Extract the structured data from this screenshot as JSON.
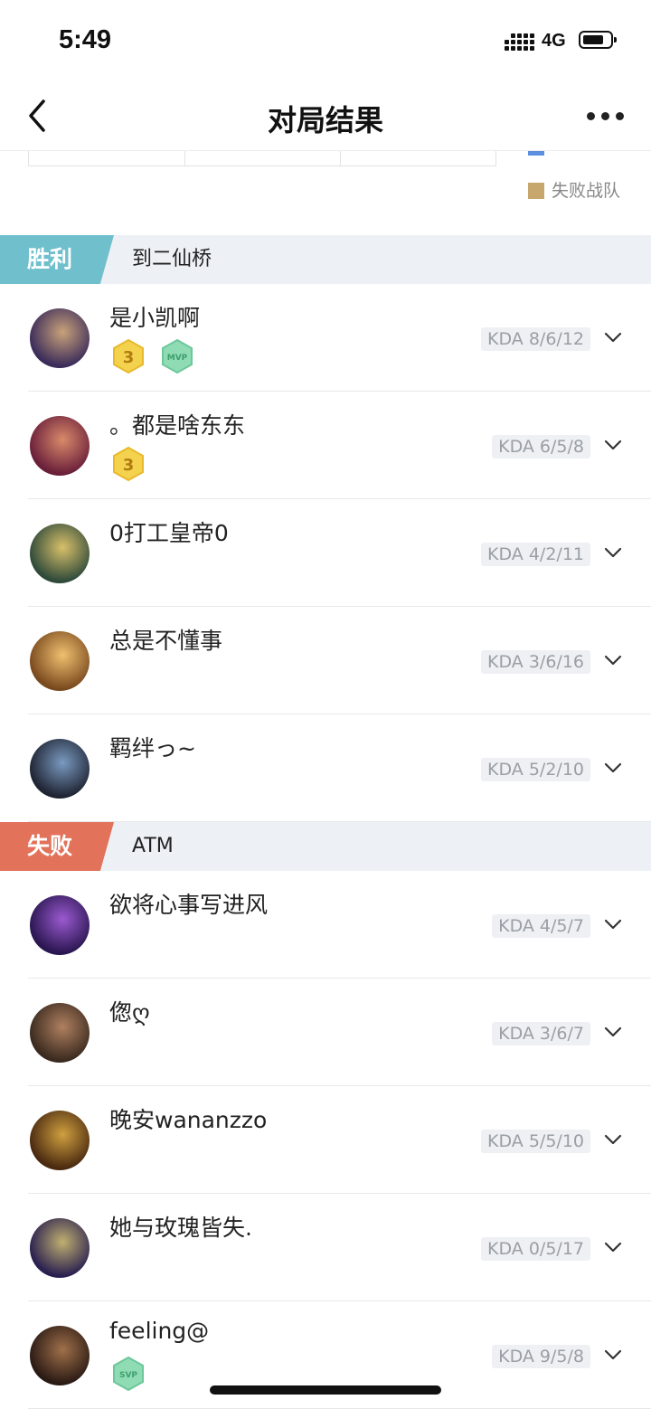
{
  "status_bar": {
    "time": "5:49",
    "network": "4G",
    "battery_level": 0.75
  },
  "nav": {
    "title": "对局结果",
    "back_icon": "chevron-left-icon",
    "more_icon": "more-horizontal-icon"
  },
  "legend": {
    "lose_label": "失败战队",
    "lose_color": "#c7a76e"
  },
  "colors": {
    "win_tag": "#6fbfcc",
    "lose_tag": "#e2725a"
  },
  "teams": [
    {
      "result": "胜利",
      "name": "到二仙桥",
      "players": [
        {
          "name": "是小凯啊",
          "kda": "KDA 8/6/12",
          "badges": [
            "3",
            "MVP"
          ]
        },
        {
          "name": "。都是啥东东",
          "kda": "KDA 6/5/8",
          "badges": [
            "3"
          ]
        },
        {
          "name": "0打工皇帝0",
          "kda": "KDA 4/2/11",
          "badges": []
        },
        {
          "name": "总是不懂事",
          "kda": "KDA 3/6/16",
          "badges": []
        },
        {
          "name": "羁绊っ~",
          "kda": "KDA 5/2/10",
          "badges": []
        }
      ]
    },
    {
      "result": "失败",
      "name": "ATM",
      "players": [
        {
          "name": "欲将心事写进风",
          "kda": "KDA 4/5/7",
          "badges": []
        },
        {
          "name": "偬ღ",
          "kda": "KDA 3/6/7",
          "badges": []
        },
        {
          "name": "晚安wananzzo",
          "kda": "KDA 5/5/10",
          "badges": []
        },
        {
          "name": "她与玫瑰皆失.",
          "kda": "KDA 0/5/17",
          "badges": []
        },
        {
          "name": "feeling@",
          "kda": "KDA 9/5/8",
          "badges": [
            "SVP"
          ]
        }
      ]
    }
  ]
}
